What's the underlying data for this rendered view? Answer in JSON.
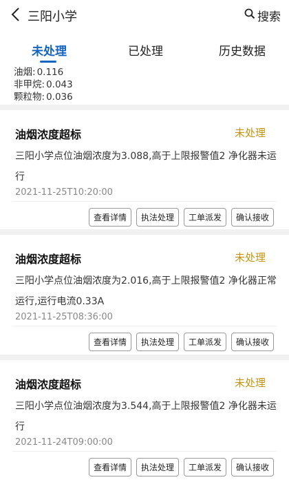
{
  "header": {
    "back_icon": "chevron-left-icon",
    "title": "三阳小学",
    "search_label": "搜索",
    "search_icon": "search-icon"
  },
  "tabs": [
    {
      "label": "未处理",
      "active": true
    },
    {
      "label": "已处理",
      "active": false
    },
    {
      "label": "历史数据",
      "active": false
    }
  ],
  "stats": [
    {
      "label": "油烟:",
      "value": "0.116"
    },
    {
      "label": "非甲烷:",
      "value": "0.043"
    },
    {
      "label": "颗粒物:",
      "value": "0.036"
    }
  ],
  "colors": {
    "accent": "#1565c0",
    "status": "#c7930a"
  },
  "alerts": [
    {
      "title": "油烟浓度超标",
      "status": "未处理",
      "description": "三阳小学点位油烟浓度为3.088,高于上限报警值2 净化器未运行",
      "time": "2021-11-25T10:20:00",
      "actions": [
        "查看详情",
        "执法处理",
        "工单派发",
        "确认接收"
      ]
    },
    {
      "title": "油烟浓度超标",
      "status": "未处理",
      "description": "三阳小学点位油烟浓度为2.016,高于上限报警值2 净化器正常运行,运行电流0.33A",
      "time": "2021-11-25T08:36:00",
      "actions": [
        "查看详情",
        "执法处理",
        "工单派发",
        "确认接收"
      ]
    },
    {
      "title": "油烟浓度超标",
      "status": "未处理",
      "description": "三阳小学点位油烟浓度为3.544,高于上限报警值2 净化器未运行",
      "time": "2021-11-24T09:00:00",
      "actions": [
        "查看详情",
        "执法处理",
        "工单派发",
        "确认接收"
      ]
    }
  ]
}
